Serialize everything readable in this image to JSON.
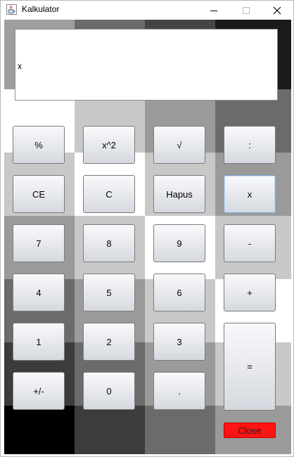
{
  "window": {
    "title": "Kalkulator",
    "app_icon": "java-coffee-cup-icon",
    "controls": [
      "minimize-icon",
      "maximize-icon",
      "close-icon"
    ]
  },
  "display": {
    "value": "x"
  },
  "buttons": {
    "row1": [
      "%",
      "x^2",
      "√",
      ":"
    ],
    "row2": [
      "CE",
      "C",
      "Hapus",
      "x"
    ],
    "row3": [
      "7",
      "8",
      "9",
      "-"
    ],
    "row4": [
      "4",
      "5",
      "6",
      "+"
    ],
    "row5": [
      "1",
      "2",
      "3"
    ],
    "row6": [
      "+/-",
      "0",
      "."
    ],
    "equals": "=",
    "close": "Close"
  },
  "colors": {
    "close_button": "#ff1414",
    "focused_border": "#7aa7d6"
  }
}
